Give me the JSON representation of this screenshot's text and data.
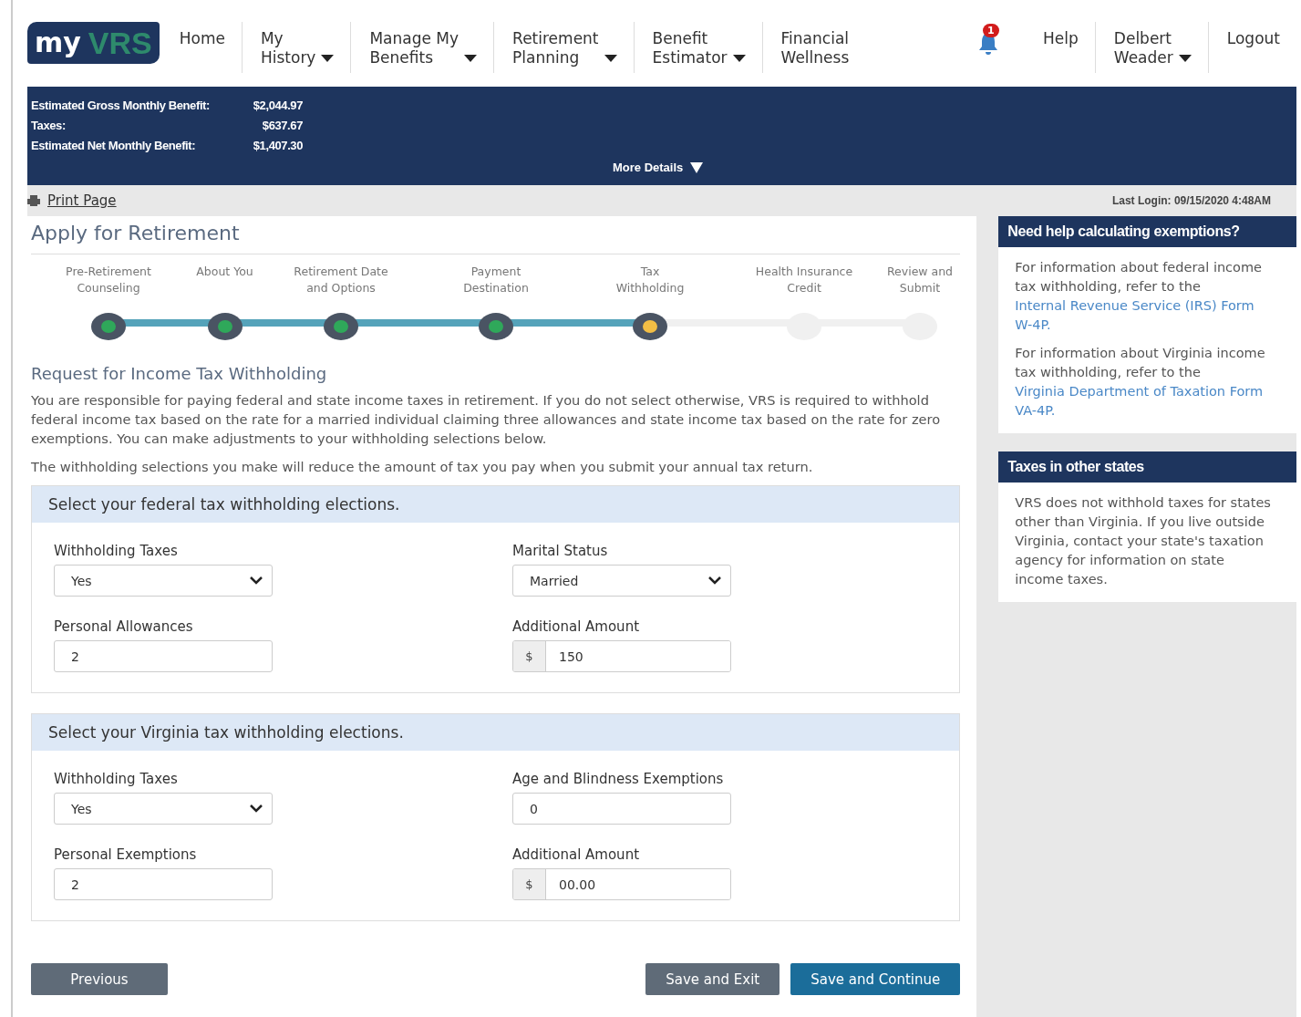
{
  "header": {
    "logo": {
      "part1": "my",
      "part2": "VRS"
    },
    "nav": [
      {
        "label": "Home",
        "dropdown": false
      },
      {
        "label": "My\nHistory",
        "dropdown": true
      },
      {
        "label": "Manage My\nBenefits",
        "dropdown": true
      },
      {
        "label": "Retirement\nPlanning",
        "dropdown": true
      },
      {
        "label": "Benefit\nEstimator",
        "dropdown": true
      },
      {
        "label": "Financial\nWellness",
        "dropdown": false
      }
    ],
    "notifications": {
      "count": "1"
    },
    "right_nav": [
      {
        "label": "Help",
        "dropdown": false
      },
      {
        "label": "Delbert\nWeader",
        "dropdown": true
      },
      {
        "label": "Logout",
        "dropdown": false
      }
    ]
  },
  "summary": {
    "rows": [
      {
        "label": "Estimated Gross Monthly Benefit:",
        "value": "$2,044.97"
      },
      {
        "label": "Taxes:",
        "value": "$637.67"
      },
      {
        "label": "Estimated Net Monthly Benefit:",
        "value": "$1,407.30"
      }
    ],
    "more_details": "More Details"
  },
  "print_page": "Print Page",
  "last_login": "Last Login: 09/15/2020 4:48AM",
  "main": {
    "title": "Apply for Retirement",
    "steps": [
      {
        "label": "Pre-Retirement\nCounseling",
        "kind": "done"
      },
      {
        "label": "About You",
        "kind": "done"
      },
      {
        "label": "Retirement Date\nand Options",
        "kind": "done"
      },
      {
        "label": "Payment\nDestination",
        "kind": "done"
      },
      {
        "label": "Tax\nWithholding",
        "kind": "current"
      },
      {
        "label": "Health Insurance\nCredit",
        "kind": "todo"
      },
      {
        "label": "Review and\nSubmit",
        "kind": "todo"
      }
    ],
    "section_title": "Request for Income Tax Withholding",
    "paragraphs": [
      "You are responsible for paying federal and state income taxes in retirement. If you do not select otherwise, VRS is required to withhold federal income tax based on the rate for a married individual claiming three allowances and state income tax based on the rate for zero exemptions. You can make adjustments to your withholding selections below.",
      "The withholding selections you make will reduce the amount of tax you pay when you submit your annual tax return."
    ],
    "forms": [
      {
        "title": "Select your federal tax withholding elections.",
        "fields": [
          {
            "label": "Withholding Taxes",
            "kind": "select",
            "value": "Yes"
          },
          {
            "label": "Marital Status",
            "kind": "select",
            "value": "Married"
          },
          {
            "label": "Personal Allowances",
            "kind": "text",
            "value": "2"
          },
          {
            "label": "Additional Amount",
            "kind": "money",
            "prefix": "$",
            "value": "150"
          }
        ]
      },
      {
        "title": "Select your Virginia tax withholding elections.",
        "fields": [
          {
            "label": "Withholding Taxes",
            "kind": "select",
            "value": "Yes"
          },
          {
            "label": "Age and Blindness Exemptions",
            "kind": "text",
            "value": "0"
          },
          {
            "label": "Personal Exemptions",
            "kind": "text",
            "value": "2"
          },
          {
            "label": "Additional Amount",
            "kind": "money",
            "prefix": "$",
            "value": "00.00"
          }
        ]
      }
    ],
    "buttons": {
      "previous": "Previous",
      "save_exit": "Save and Exit",
      "save_continue": "Save and Continue"
    }
  },
  "sidebar": [
    {
      "title": "Need help calculating exemptions?",
      "paragraphs": [
        {
          "text": "For information about federal income tax withholding, refer to the",
          "link": "Internal Revenue Service (IRS) Form W-4P."
        },
        {
          "text": "For information about Virginia income tax withholding, refer to the",
          "link": "Virginia Department of Taxation Form VA-4P."
        }
      ]
    },
    {
      "title": "Taxes in other states",
      "paragraphs": [
        {
          "text": "VRS does not withhold taxes for states other than Virginia. If you live outside Virginia, contact your state's taxation agency for information on state income taxes."
        }
      ]
    }
  ]
}
